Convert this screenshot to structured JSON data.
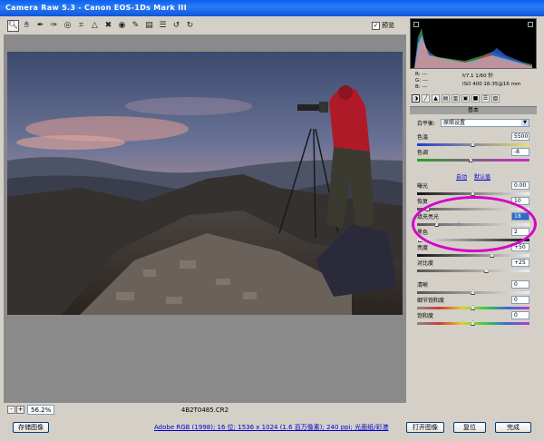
{
  "window": {
    "title": "Camera Raw 5.3 -  Canon EOS-1Ds Mark III"
  },
  "toolbar": {
    "tools": [
      "zoom-icon",
      "hand-icon",
      "white-balance-eyedropper-icon",
      "color-sampler-icon",
      "target-adjust-icon",
      "crop-icon",
      "straighten-icon",
      "spot-removal-icon",
      "red-eye-icon",
      "adjustment-brush-icon",
      "graduated-filter-icon",
      "list-icon",
      "rotate-ccw-icon",
      "rotate-cw-icon"
    ],
    "preview_label": "预览",
    "preview_checked": true
  },
  "histogram": {
    "rgb_labels": [
      "R:",
      "G:",
      "B:"
    ],
    "rgb_values": [
      "---",
      "---",
      "---"
    ],
    "aperture_shutter": "f/7.1   1/60 秒",
    "iso_lens": "ISO 400   16-35@16 mm"
  },
  "panel": {
    "tab_icons": [
      "basic-icon",
      "tone-curve-icon",
      "detail-icon",
      "hsl-icon",
      "split-toning-icon",
      "lens-icon",
      "camera-calibration-icon",
      "presets-icon",
      "snapshots-icon"
    ],
    "section_title": "基本",
    "white_balance": {
      "label": "白平衡:",
      "value": "原照设置"
    },
    "temperature": {
      "label": "色温",
      "value": "5500",
      "level": 0.5
    },
    "tint": {
      "label": "色调",
      "value": "-8",
      "level": 0.48
    },
    "auto_label": "自动",
    "default_label": "默认值",
    "exposure": {
      "label": "曝光",
      "value": "0.00",
      "level": 0.5
    },
    "recovery": {
      "label": "恢复",
      "value": "10",
      "level": 0.1
    },
    "fill_light": {
      "label": "填充亮光",
      "value": "18",
      "level": 0.18
    },
    "blacks": {
      "label": "黑色",
      "value": "2",
      "level": 0.03
    },
    "brightness": {
      "label": "亮度",
      "value": "+50",
      "level": 0.67
    },
    "contrast": {
      "label": "对比度",
      "value": "+25",
      "level": 0.62
    },
    "clarity": {
      "label": "清晰",
      "value": "0",
      "level": 0.5
    },
    "vibrance": {
      "label": "细节饱和度",
      "value": "0",
      "level": 0.5
    },
    "saturation": {
      "label": "饱和度",
      "value": "0",
      "level": 0.5
    }
  },
  "status": {
    "zoom": "56.2%",
    "filename": "4B2T0485.CR2"
  },
  "bottom": {
    "save_button": "存储图像",
    "workflow_link": "Adobe RGB (1998); 16 位; 1536 x 1024 (1.6 百万像素); 240 ppi; 光面纸/彩港",
    "open_button": "打开图像",
    "reset_button": "复位",
    "done_button": "完成"
  },
  "colors": {
    "accent": "#0a5ff0",
    "annotation": "#d800c8"
  }
}
